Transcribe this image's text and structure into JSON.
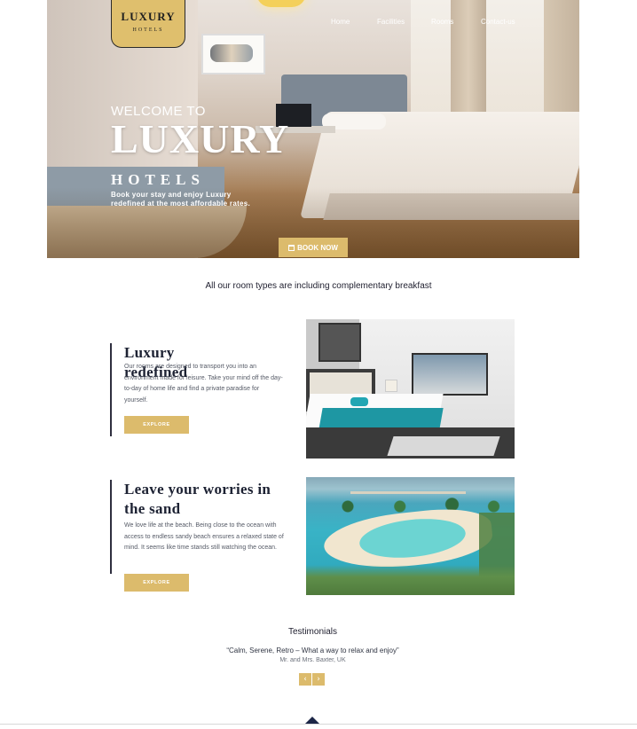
{
  "logo": {
    "main": "LUXURY",
    "sub": "HOTELS"
  },
  "nav": {
    "items": [
      "Home",
      "Facilities",
      "Rooms",
      "Contact-us"
    ]
  },
  "hero": {
    "welcome": "WELCOME TO",
    "headline": "LUXURY",
    "subheadline": "HOTELS",
    "tagline": "Book your stay and enjoy Luxury redefined at the most affordable rates.",
    "book_label": "BOOK NOW",
    "book_icon": "calendar-icon"
  },
  "intro": "All our room types are including complementary breakfast",
  "features": [
    {
      "title": "Luxury redefined",
      "description": "Our rooms are designed to transport you into an environment made for leisure. Take your mind off the day-to-day of home life and find a private paradise for yourself.",
      "button": "EXPLORE"
    },
    {
      "title": "Leave your worries in the sand",
      "description": "We love life at the beach. Being close to the ocean with access to endless sandy beach ensures a relaxed state of mind. It seems like time stands still watching the ocean.",
      "button": "EXPLORE"
    }
  ],
  "testimonials": {
    "title": "Testimonials",
    "quote": "“Calm, Serene, Retro – What a way to relax and enjoy”",
    "author": "Mr. and Mrs. Baxter, UK",
    "prev_icon": "chevron-left-icon",
    "next_icon": "chevron-right-icon"
  },
  "colors": {
    "accent": "#dcbb6c",
    "navy": "#1c2647",
    "text": "#1e1e2e"
  }
}
